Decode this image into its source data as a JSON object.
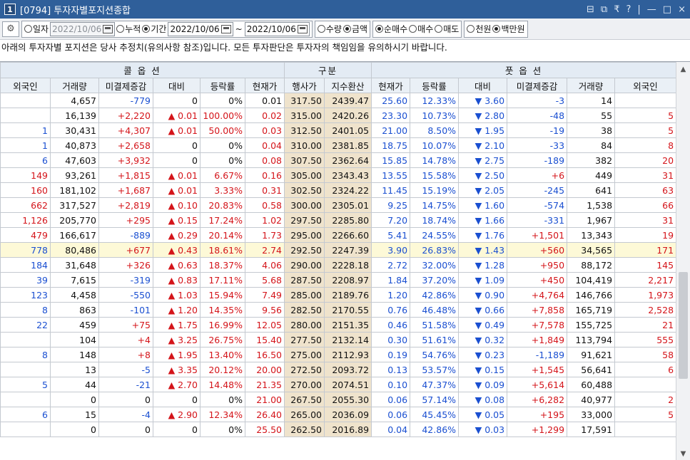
{
  "window": {
    "number": "1",
    "title": "[0794] 투자자별포지션종합",
    "controls": [
      "⊟",
      "⧉",
      "₹",
      "?",
      "|",
      "—",
      "□",
      "×"
    ]
  },
  "toolbar": {
    "gear_icon": "gear-icon",
    "date_mode": {
      "options": [
        "일자",
        "누적",
        "기간"
      ],
      "selected": "기간"
    },
    "single_date": "2022/10/06",
    "period_from": "2022/10/06",
    "period_sep": "~",
    "period_to": "2022/10/06",
    "measure": {
      "options": [
        "수량",
        "금액"
      ],
      "selected": "금액"
    },
    "trade_type": {
      "options": [
        "순매수",
        "매수",
        "매도"
      ],
      "selected": "순매수"
    },
    "unit": {
      "options": [
        "천원",
        "백만원"
      ],
      "selected": "백만원"
    }
  },
  "notice": "아래의 투자자별 포지션은 당사 추정치(유의사항 참조)입니다. 모든 투자판단은 투자자의 책임임을 유의하시기 바랍니다.",
  "grid": {
    "group_headers": {
      "call": "콜 옵 션",
      "center": "구분",
      "put": "풋 옵 션"
    },
    "columns": [
      "외국인",
      "거래량",
      "미결제증감",
      "대비",
      "등락률",
      "현재가",
      "행사가",
      "지수환산",
      "현재가",
      "등락률",
      "대비",
      "미결제증감",
      "거래량",
      "외국인"
    ],
    "rows": [
      [
        "",
        "4,657",
        "-779",
        "0",
        "0%",
        "0.01",
        "317.50",
        "2439.47",
        "25.60",
        "12.33%",
        "▼ 3.60",
        "-3",
        "14",
        ""
      ],
      [
        "",
        "16,139",
        "+2,220",
        "▲ 0.01",
        "100.00%",
        "0.02",
        "315.00",
        "2420.26",
        "23.30",
        "10.73%",
        "▼ 2.80",
        "-48",
        "55",
        "5"
      ],
      [
        "1",
        "30,431",
        "+4,307",
        "▲ 0.01",
        "50.00%",
        "0.03",
        "312.50",
        "2401.05",
        "21.00",
        "8.50%",
        "▼ 1.95",
        "-19",
        "38",
        "5"
      ],
      [
        "1",
        "40,873",
        "+2,658",
        "0",
        "0%",
        "0.04",
        "310.00",
        "2381.85",
        "18.75",
        "10.07%",
        "▼ 2.10",
        "-33",
        "84",
        "8"
      ],
      [
        "6",
        "47,603",
        "+3,932",
        "0",
        "0%",
        "0.08",
        "307.50",
        "2362.64",
        "15.85",
        "14.78%",
        "▼ 2.75",
        "-189",
        "382",
        "20"
      ],
      [
        "149",
        "93,261",
        "+1,815",
        "▲ 0.01",
        "6.67%",
        "0.16",
        "305.00",
        "2343.43",
        "13.55",
        "15.58%",
        "▼ 2.50",
        "+6",
        "449",
        "31"
      ],
      [
        "160",
        "181,102",
        "+1,687",
        "▲ 0.01",
        "3.33%",
        "0.31",
        "302.50",
        "2324.22",
        "11.45",
        "15.19%",
        "▼ 2.05",
        "-245",
        "641",
        "63"
      ],
      [
        "662",
        "317,527",
        "+2,819",
        "▲ 0.10",
        "20.83%",
        "0.58",
        "300.00",
        "2305.01",
        "9.25",
        "14.75%",
        "▼ 1.60",
        "-574",
        "1,538",
        "66"
      ],
      [
        "1,126",
        "205,770",
        "+295",
        "▲ 0.15",
        "17.24%",
        "1.02",
        "297.50",
        "2285.80",
        "7.20",
        "18.74%",
        "▼ 1.66",
        "-331",
        "1,967",
        "31"
      ],
      [
        "479",
        "166,617",
        "-889",
        "▲ 0.29",
        "20.14%",
        "1.73",
        "295.00",
        "2266.60",
        "5.41",
        "24.55%",
        "▼ 1.76",
        "+1,501",
        "13,343",
        "19"
      ],
      [
        "778",
        "80,486",
        "+677",
        "▲ 0.43",
        "18.61%",
        "2.74",
        "292.50",
        "2247.39",
        "3.90",
        "26.83%",
        "▼ 1.43",
        "+560",
        "34,565",
        "171"
      ],
      [
        "184",
        "31,648",
        "+326",
        "▲ 0.63",
        "18.37%",
        "4.06",
        "290.00",
        "2228.18",
        "2.72",
        "32.00%",
        "▼ 1.28",
        "+950",
        "88,172",
        "145"
      ],
      [
        "39",
        "7,615",
        "-319",
        "▲ 0.83",
        "17.11%",
        "5.68",
        "287.50",
        "2208.97",
        "1.84",
        "37.20%",
        "▼ 1.09",
        "+450",
        "104,419",
        "2,217"
      ],
      [
        "123",
        "4,458",
        "-550",
        "▲ 1.03",
        "15.94%",
        "7.49",
        "285.00",
        "2189.76",
        "1.20",
        "42.86%",
        "▼ 0.90",
        "+4,764",
        "146,766",
        "1,973"
      ],
      [
        "8",
        "863",
        "-101",
        "▲ 1.20",
        "14.35%",
        "9.56",
        "282.50",
        "2170.55",
        "0.76",
        "46.48%",
        "▼ 0.66",
        "+7,858",
        "165,719",
        "2,528"
      ],
      [
        "22",
        "459",
        "+75",
        "▲ 1.75",
        "16.99%",
        "12.05",
        "280.00",
        "2151.35",
        "0.46",
        "51.58%",
        "▼ 0.49",
        "+7,578",
        "155,725",
        "21"
      ],
      [
        "",
        "104",
        "+4",
        "▲ 3.25",
        "26.75%",
        "15.40",
        "277.50",
        "2132.14",
        "0.30",
        "51.61%",
        "▼ 0.32",
        "+1,849",
        "113,794",
        "555"
      ],
      [
        "8",
        "148",
        "+8",
        "▲ 1.95",
        "13.40%",
        "16.50",
        "275.00",
        "2112.93",
        "0.19",
        "54.76%",
        "▼ 0.23",
        "-1,189",
        "91,621",
        "58"
      ],
      [
        "",
        "13",
        "-5",
        "▲ 3.35",
        "20.12%",
        "20.00",
        "272.50",
        "2093.72",
        "0.13",
        "53.57%",
        "▼ 0.15",
        "+1,545",
        "56,641",
        "6"
      ],
      [
        "5",
        "44",
        "-21",
        "▲ 2.70",
        "14.48%",
        "21.35",
        "270.00",
        "2074.51",
        "0.10",
        "47.37%",
        "▼ 0.09",
        "+5,614",
        "60,488",
        ""
      ],
      [
        "",
        "0",
        "0",
        "0",
        "0%",
        "21.00",
        "267.50",
        "2055.30",
        "0.06",
        "57.14%",
        "▼ 0.08",
        "+6,282",
        "40,977",
        "2"
      ],
      [
        "6",
        "15",
        "-4",
        "▲ 2.90",
        "12.34%",
        "26.40",
        "265.00",
        "2036.09",
        "0.06",
        "45.45%",
        "▼ 0.05",
        "+195",
        "33,000",
        "5"
      ],
      [
        "",
        "0",
        "0",
        "0",
        "0%",
        "25.50",
        "262.50",
        "2016.89",
        "0.04",
        "42.86%",
        "▼ 0.03",
        "+1,299",
        "17,591",
        ""
      ]
    ],
    "highlighted_row": 10,
    "colors": {
      "up": "#d4141a",
      "down": "#1a4fd1",
      "center_bg": "#efe3cc",
      "highlight_bg": "#fdf9d7",
      "title_bg": "#2f5f9a"
    }
  },
  "scrollbar": {
    "up_icon": "chevron-up-icon",
    "down_icon": "chevron-down-icon"
  }
}
